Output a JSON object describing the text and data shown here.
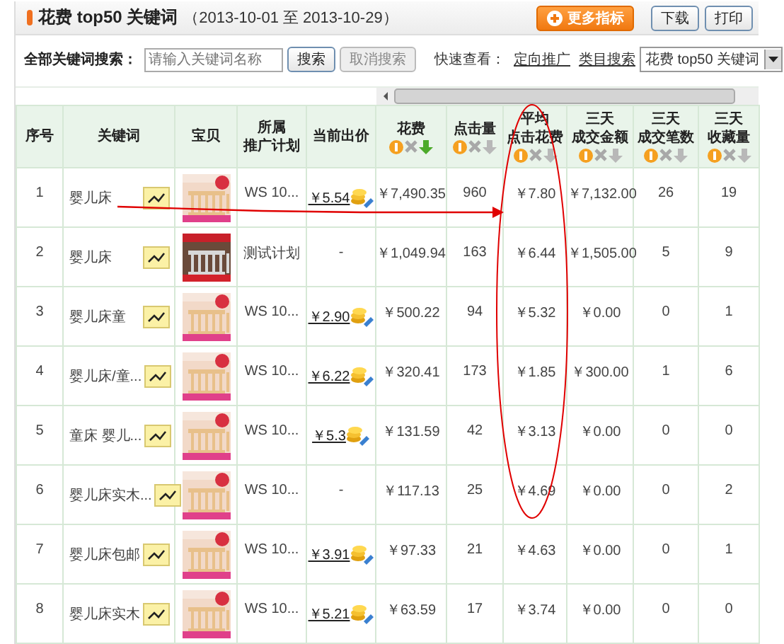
{
  "header": {
    "title": "花费 top50 关键词",
    "date_range": "（2013-10-01 至 2013-10-29）",
    "buttons": [
      {
        "kind": "primary",
        "label": "更多指标"
      },
      {
        "kind": "plain",
        "label": "下载"
      },
      {
        "kind": "plain",
        "label": "打印"
      }
    ]
  },
  "search": {
    "label": "全部关键词搜索：",
    "placeholder": "请输入关键词名称",
    "buttons": [
      {
        "label": "搜索",
        "disabled": false
      },
      {
        "label": "取消搜索",
        "disabled": true
      }
    ],
    "quick_label": "快速查看：",
    "quick_links": [
      "定向推广",
      "类目搜索"
    ],
    "select": {
      "value": "花费 top50 关键词"
    }
  },
  "table": {
    "columns": [
      {
        "lines": [
          "序号"
        ]
      },
      {
        "lines": [
          "关键词"
        ]
      },
      {
        "lines": [
          "宝贝"
        ]
      },
      {
        "lines": [
          "所属",
          "推广计划"
        ]
      },
      {
        "lines": [
          "当前出价"
        ]
      },
      {
        "lines": [
          "花费"
        ],
        "sorted": true
      },
      {
        "lines": [
          "点击量"
        ],
        "sorted": false
      },
      {
        "lines": [
          "平均",
          "点击花费"
        ],
        "sorted": false
      },
      {
        "lines": [
          "三天",
          "成交金额"
        ],
        "sorted": false
      },
      {
        "lines": [
          "三天",
          "成交笔数"
        ],
        "sorted": false
      },
      {
        "lines": [
          "三天",
          "收藏量"
        ],
        "sorted": false
      }
    ],
    "rows": [
      {
        "index": "1",
        "keyword": "婴儿床",
        "plan": "WS 10...",
        "bid": "￥5.54",
        "cost": "￥7,490.35",
        "clicks": "960",
        "avg_cost": "￥7.80",
        "amount": "￥7,132.00",
        "orders": "26",
        "favorites": "19"
      },
      {
        "index": "2",
        "keyword": "婴儿床",
        "plan": "测试计划",
        "bid": "-",
        "cost": "￥1,049.94",
        "clicks": "163",
        "avg_cost": "￥6.44",
        "amount": "￥1,505.00",
        "orders": "5",
        "favorites": "9"
      },
      {
        "index": "3",
        "keyword": "婴儿床童",
        "plan": "WS 10...",
        "bid": "￥2.90",
        "cost": "￥500.22",
        "clicks": "94",
        "avg_cost": "￥5.32",
        "amount": "￥0.00",
        "orders": "0",
        "favorites": "1"
      },
      {
        "index": "4",
        "keyword": "婴儿床/童...",
        "plan": "WS 10...",
        "bid": "￥6.22",
        "cost": "￥320.41",
        "clicks": "173",
        "avg_cost": "￥1.85",
        "amount": "￥300.00",
        "orders": "1",
        "favorites": "6"
      },
      {
        "index": "5",
        "keyword": "童床 婴儿...",
        "plan": "WS 10...",
        "bid": "￥5.3",
        "cost": "￥131.59",
        "clicks": "42",
        "avg_cost": "￥3.13",
        "amount": "￥0.00",
        "orders": "0",
        "favorites": "0"
      },
      {
        "index": "6",
        "keyword": "婴儿床实木...",
        "plan": "WS 10...",
        "bid": "-",
        "cost": "￥117.13",
        "clicks": "25",
        "avg_cost": "￥4.69",
        "amount": "￥0.00",
        "orders": "0",
        "favorites": "2"
      },
      {
        "index": "7",
        "keyword": "婴儿床包邮",
        "plan": "WS 10...",
        "bid": "￥3.91",
        "cost": "￥97.33",
        "clicks": "21",
        "avg_cost": "￥4.63",
        "amount": "￥0.00",
        "orders": "0",
        "favorites": "1"
      },
      {
        "index": "8",
        "keyword": "婴儿床实木",
        "plan": "WS 10...",
        "bid": "￥5.21",
        "cost": "￥63.59",
        "clicks": "17",
        "avg_cost": "￥3.74",
        "amount": "￥0.00",
        "orders": "0",
        "favorites": "0"
      }
    ]
  }
}
